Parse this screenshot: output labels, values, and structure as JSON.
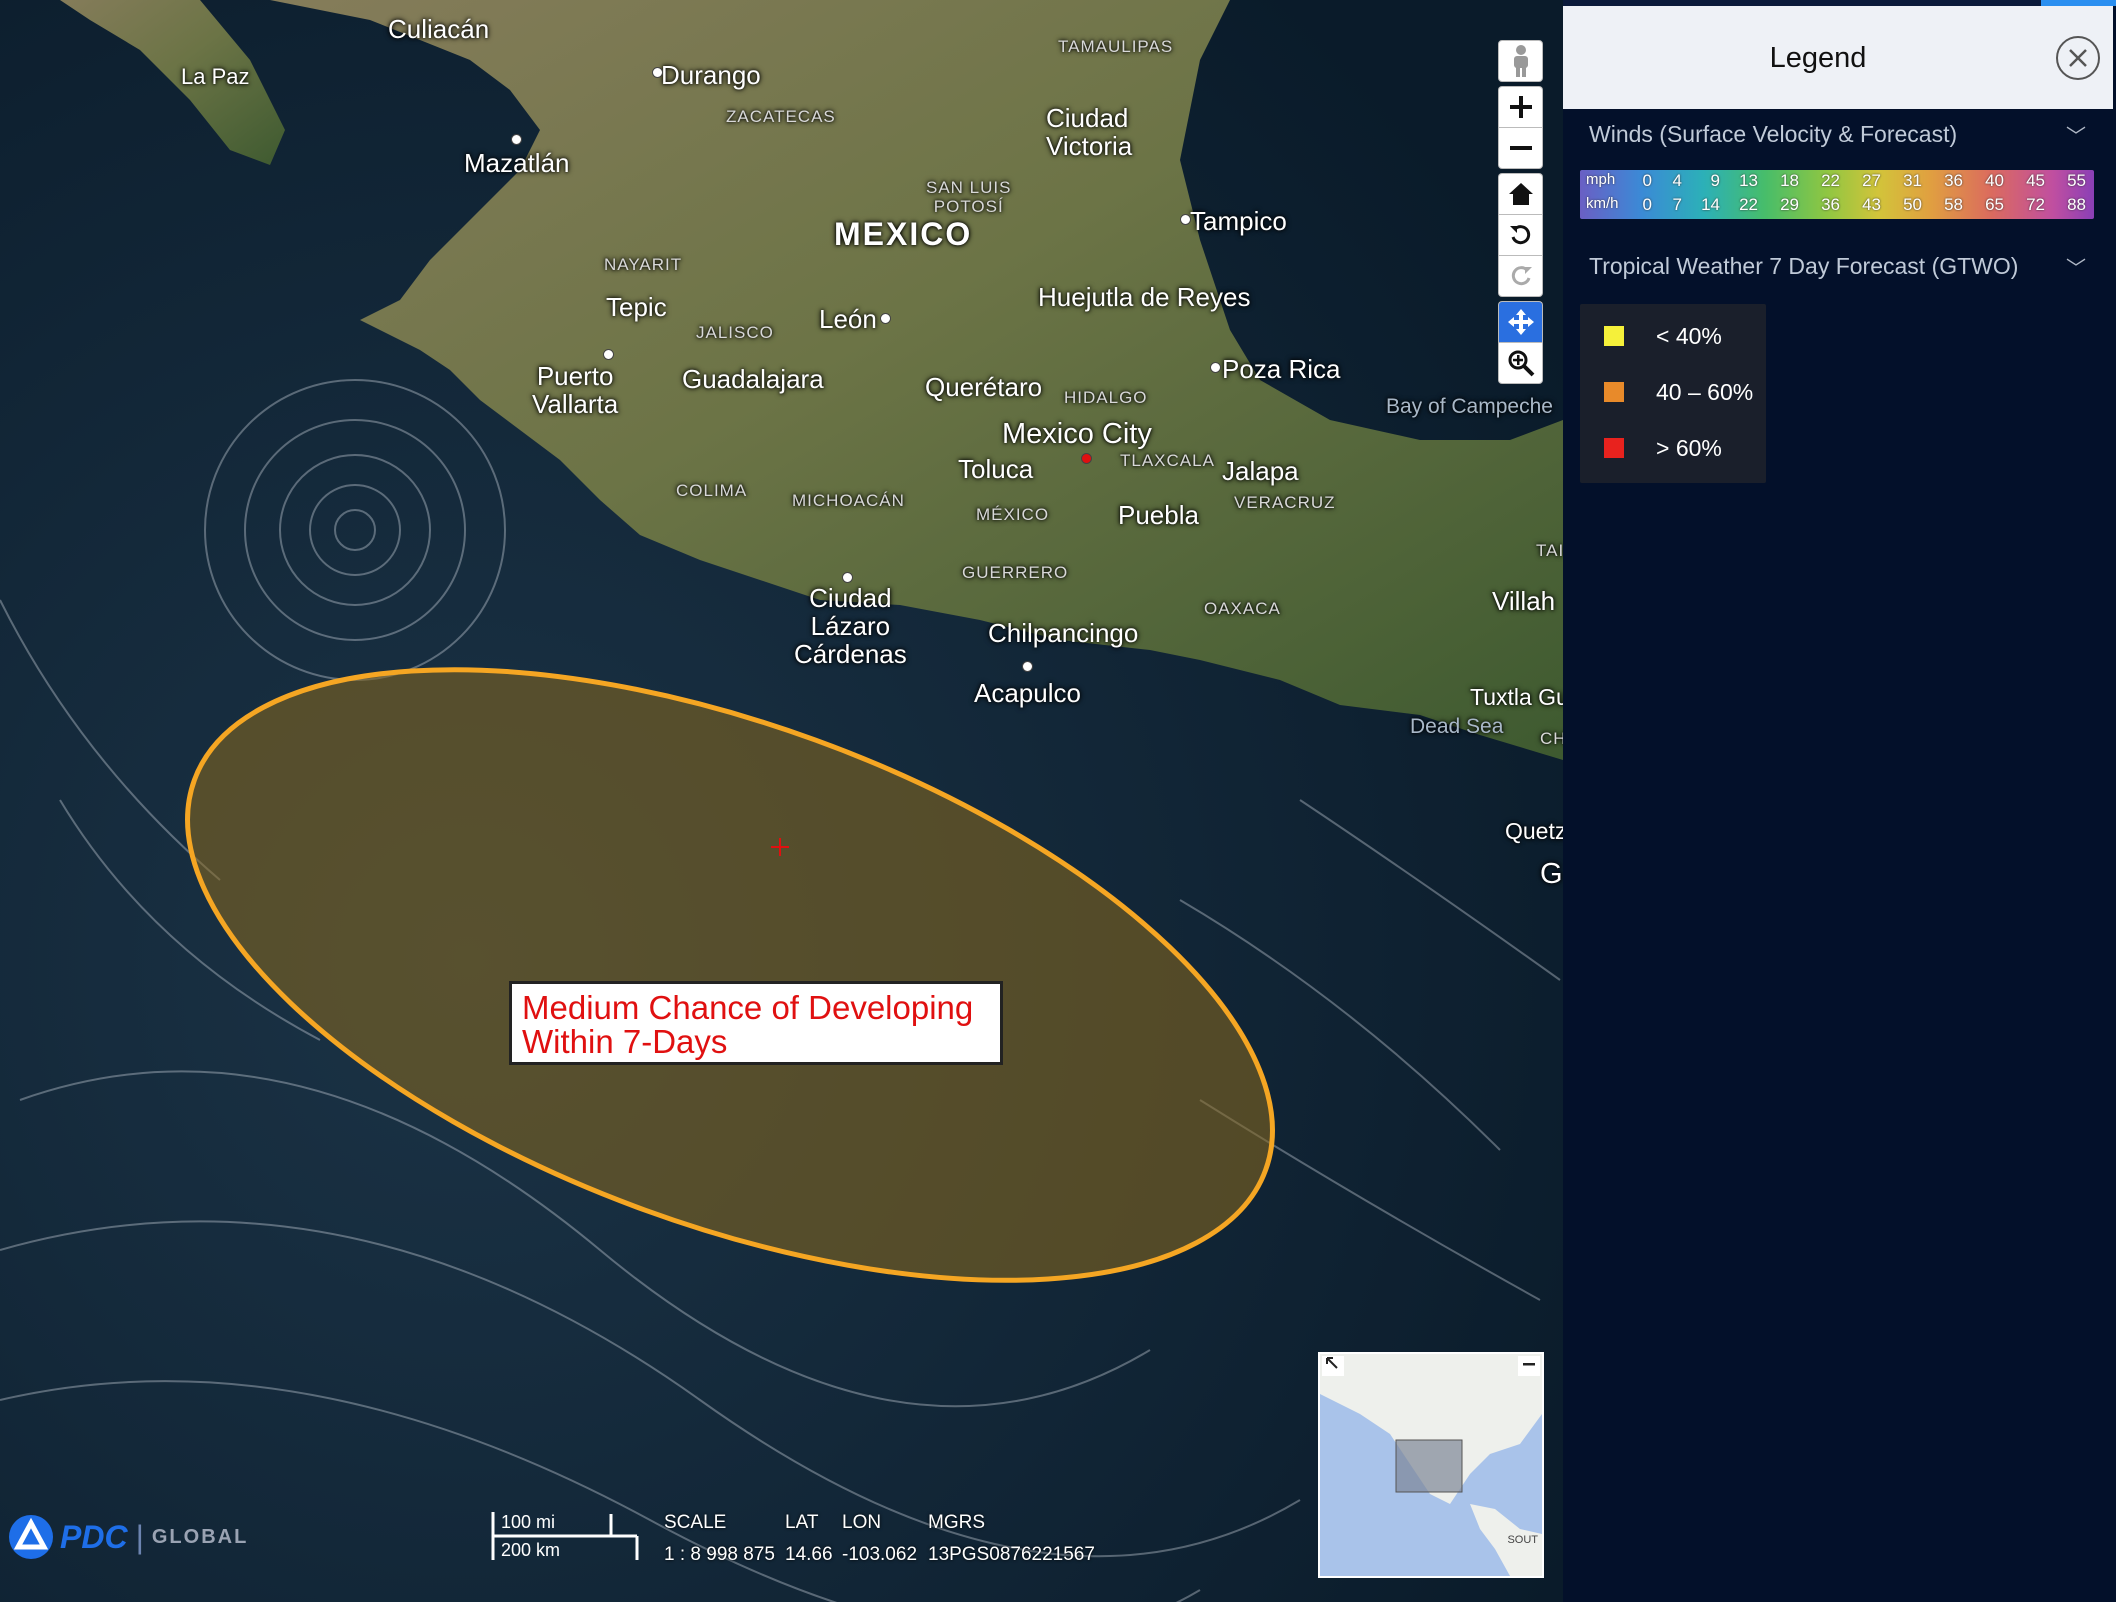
{
  "map": {
    "places": [
      {
        "id": "culiacan",
        "label": "Culiacán"
      },
      {
        "id": "la-paz",
        "label": "La Paz"
      },
      {
        "id": "durango",
        "label": "Durango"
      },
      {
        "id": "tamaulipas",
        "label": "TAMAULIPAS"
      },
      {
        "id": "zacatecas",
        "label": "ZACATECAS"
      },
      {
        "id": "ciudad-victoria",
        "label": "Ciudad\nVictoria"
      },
      {
        "id": "mazatlan",
        "label": "Mazatlán"
      },
      {
        "id": "san-luis-potosi",
        "label": "SAN LUIS\nPOTOSÍ"
      },
      {
        "id": "mexico-country",
        "label": "MEXICO"
      },
      {
        "id": "tampico",
        "label": "Tampico"
      },
      {
        "id": "nayarit",
        "label": "NAYARIT"
      },
      {
        "id": "tepic",
        "label": "Tepic"
      },
      {
        "id": "huejutla",
        "label": "Huejutla de Reyes"
      },
      {
        "id": "jalisco",
        "label": "JALISCO"
      },
      {
        "id": "leon",
        "label": "León"
      },
      {
        "id": "puerto-vallarta",
        "label": "Puerto\nVallarta"
      },
      {
        "id": "guadalajara",
        "label": "Guadalajara"
      },
      {
        "id": "queretaro",
        "label": "Querétaro"
      },
      {
        "id": "poza-rica",
        "label": "Poza Rica"
      },
      {
        "id": "hidalgo",
        "label": "HIDALGO"
      },
      {
        "id": "bay-of-campeche",
        "label": "Bay of Campeche"
      },
      {
        "id": "mexico-city",
        "label": "Mexico City"
      },
      {
        "id": "tlaxcala",
        "label": "TLAXCALA"
      },
      {
        "id": "toluca",
        "label": "Toluca"
      },
      {
        "id": "jalapa",
        "label": "Jalapa"
      },
      {
        "id": "colima",
        "label": "COLIMA"
      },
      {
        "id": "michoacan",
        "label": "MICHOACÁN"
      },
      {
        "id": "veracruz",
        "label": "VERACRUZ"
      },
      {
        "id": "mexico-state",
        "label": "MÉXICO"
      },
      {
        "id": "puebla",
        "label": "Puebla"
      },
      {
        "id": "tab",
        "label": "TAI"
      },
      {
        "id": "guerrero",
        "label": "GUERRERO"
      },
      {
        "id": "ciudad-lazaro",
        "label": "Ciudad\nLázaro\nCárdenas"
      },
      {
        "id": "villah",
        "label": "Villah"
      },
      {
        "id": "oaxaca",
        "label": "OAXACA"
      },
      {
        "id": "chilpancingo",
        "label": "Chilpancingo"
      },
      {
        "id": "acapulco",
        "label": "Acapulco"
      },
      {
        "id": "tuxtla",
        "label": "Tuxtla Gu"
      },
      {
        "id": "dead-sea",
        "label": "Dead Sea"
      },
      {
        "id": "ch",
        "label": "CH"
      },
      {
        "id": "quetz",
        "label": "Quetz"
      },
      {
        "id": "g",
        "label": "G"
      }
    ],
    "annotation": "Medium Chance of Developing\nWithin 7-Days",
    "toolbar": [
      "street-view",
      "zoom-in",
      "zoom-out",
      "home",
      "rotate-left",
      "rotate-right",
      "pan",
      "zoom-box"
    ],
    "branding": {
      "logo": "PDC",
      "separator": "|",
      "sub": "GLOBAL"
    },
    "scalebar": {
      "top": "100 mi",
      "bottom": "200 km"
    },
    "readout": {
      "scale_label": "SCALE",
      "scale_value": "1 : 8 998 875",
      "lat_label": "LAT",
      "lat_value": "14.66",
      "lon_label": "LON",
      "lon_value": "-103.062",
      "mgrs_label": "MGRS",
      "mgrs_value": "13PGS0876221567"
    },
    "minimap": {
      "label": "SOUT"
    },
    "colors": {
      "forecast_outline": "#f5a623",
      "forecast_fill": "#8a6a1e",
      "ocean": "#0e2233",
      "land": "#5f6b3e"
    }
  },
  "legend": {
    "title": "Legend",
    "sections": [
      {
        "title": "Winds (Surface Velocity & Forecast)"
      },
      {
        "title": "Tropical Weather 7 Day Forecast (GTWO)"
      }
    ],
    "wind_scale": {
      "mph_label": "mph",
      "kmh_label": "km/h",
      "mph": [
        "0",
        "4",
        "9",
        "13",
        "18",
        "22",
        "27",
        "31",
        "36",
        "40",
        "45",
        "55"
      ],
      "kmh": [
        "0",
        "7",
        "14",
        "22",
        "29",
        "36",
        "43",
        "50",
        "58",
        "65",
        "72",
        "88"
      ]
    },
    "gtwo_items": [
      {
        "label": "< 40%",
        "color": "#f5f03a"
      },
      {
        "label": "40 – 60%",
        "color": "#e88a2a"
      },
      {
        "label": "> 60%",
        "color": "#e8221e"
      }
    ]
  }
}
